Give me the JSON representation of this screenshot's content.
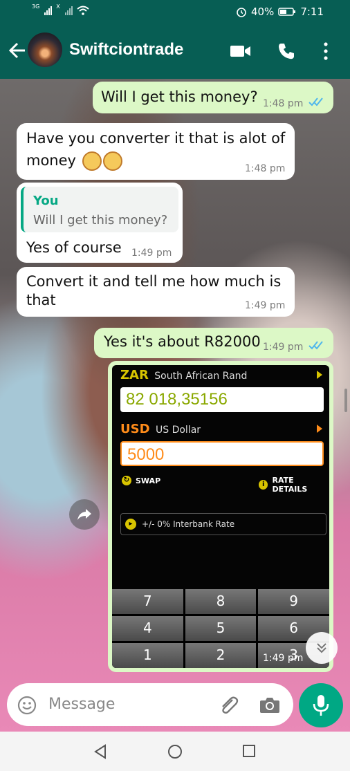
{
  "status_bar": {
    "network1": "3G",
    "network2": "X",
    "battery": "40%",
    "time": "7:11"
  },
  "header": {
    "contact_name": "Swiftciontrade"
  },
  "messages": [
    {
      "dir": "out",
      "text": "Will I get this money?",
      "time": "1:48 pm",
      "read": true
    },
    {
      "dir": "in",
      "text": "Have you converter it that is alot of money",
      "time": "1:48 pm"
    },
    {
      "dir": "in",
      "reply_author": "You",
      "reply_text": "Will I get this money?",
      "text": "Yes of course",
      "time": "1:49 pm"
    },
    {
      "dir": "in",
      "text": "Convert it and tell me how much is that",
      "time": "1:49 pm"
    },
    {
      "dir": "out",
      "text": "Yes it's about R82000",
      "time": "1:49 pm",
      "read": true
    },
    {
      "dir": "out",
      "image": true,
      "time": "1:49 pm"
    }
  ],
  "converter": {
    "from_code": "ZAR",
    "from_name": "South African Rand",
    "from_value": "82 018,35156",
    "to_code": "USD",
    "to_name": "US Dollar",
    "to_value": "5000",
    "swap_label": "SWAP",
    "rate_details_label": "RATE DETAILS",
    "rate_label": "+/- 0% Interbank Rate",
    "keys": [
      "7",
      "8",
      "9",
      "4",
      "5",
      "6",
      "1",
      "2",
      "3"
    ],
    "colors": {
      "zar": "#d8c400",
      "usd": "#ff8c1a",
      "zar_value": "#8aa800",
      "usd_value": "#ff8c1a"
    }
  },
  "composer": {
    "placeholder": "Message"
  },
  "colors": {
    "header": "#075e54",
    "outgoing": "#dcf8c6",
    "incoming": "#ffffff",
    "accent": "#00a884",
    "read_ticks": "#4fb6ec"
  }
}
